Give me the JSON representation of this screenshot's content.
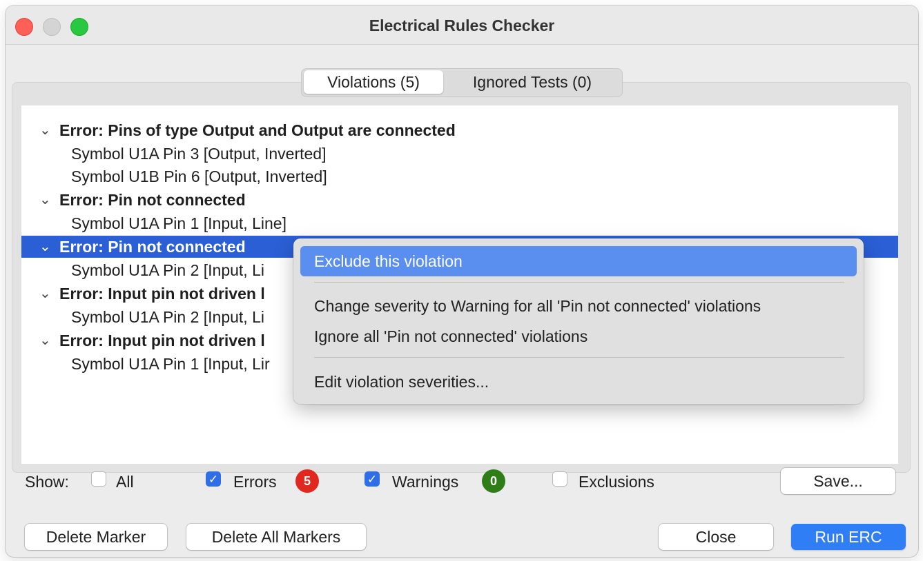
{
  "window": {
    "title": "Electrical Rules Checker"
  },
  "tabs": [
    {
      "label": "Violations (5)",
      "active": true
    },
    {
      "label": "Ignored Tests (0)",
      "active": false
    }
  ],
  "violations": [
    {
      "label": "Error: Pins of type Output and Output are connected",
      "children": [
        "Symbol U1A Pin 3 [Output, Inverted]",
        "Symbol U1B Pin 6 [Output, Inverted]"
      ]
    },
    {
      "label": "Error: Pin not connected",
      "children": [
        "Symbol U1A Pin 1 [Input, Line]"
      ]
    },
    {
      "label": "Error: Pin not connected",
      "children": [
        "Symbol U1A Pin 2 [Input, Li"
      ],
      "selected": true
    },
    {
      "label": "Error: Input pin not driven l",
      "children": [
        "Symbol U1A Pin 2 [Input, Li"
      ]
    },
    {
      "label": "Error: Input pin not driven l",
      "children": [
        "Symbol U1A Pin 1 [Input, Lir"
      ]
    }
  ],
  "context_menu": {
    "items": [
      "Exclude this violation",
      "Change severity to Warning for all 'Pin not connected' violations",
      "Ignore all 'Pin not connected' violations",
      "Edit violation severities..."
    ]
  },
  "filters": {
    "show_label": "Show:",
    "all": {
      "label": "All",
      "checked": false
    },
    "errors": {
      "label": "Errors",
      "checked": true,
      "count": "5"
    },
    "warnings": {
      "label": "Warnings",
      "checked": true,
      "count": "0"
    },
    "exclusions": {
      "label": "Exclusions",
      "checked": false
    },
    "save": "Save..."
  },
  "buttons": {
    "delete_marker": "Delete Marker",
    "delete_all_markers": "Delete All Markers",
    "close": "Close",
    "run_erc": "Run ERC"
  },
  "icons": {
    "expanded": "chevron-down-icon",
    "check": "checkmark-icon"
  },
  "colors": {
    "selection": "#2a5fd5",
    "menu_highlight": "#5a8ff0",
    "error_badge": "#e0281e",
    "warning_badge": "#2e7d16",
    "primary_button": "#2f7ef5",
    "checkbox": "#2f6ee6"
  }
}
